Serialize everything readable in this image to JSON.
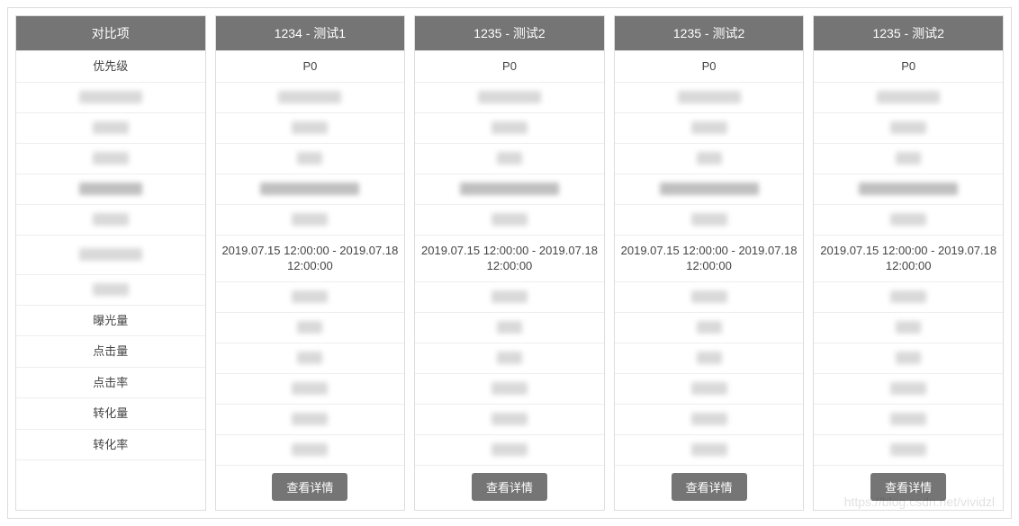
{
  "headers": {
    "compare": "对比项",
    "cols": [
      "1234 - 测试1",
      "1235 - 测试2",
      "1235 - 测试2",
      "1235 - 测试2"
    ]
  },
  "row_labels": {
    "priority": "优先级",
    "exposure": "曝光量",
    "clicks": "点击量",
    "ctr": "点击率",
    "conversions": "转化量",
    "cvr": "转化率"
  },
  "priority_value": "P0",
  "date_range": "2019.07.15 12:00:00 - 2019.07.18 12:00:00",
  "button_label": "查看详情",
  "watermark": "https://blog.csdn.net/vividzl"
}
